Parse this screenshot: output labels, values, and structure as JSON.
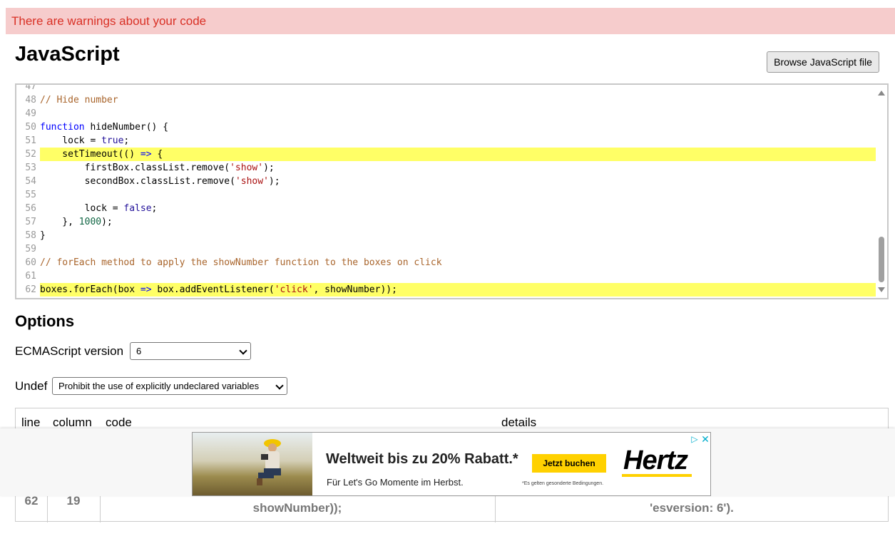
{
  "banner": {
    "warning_text": "There are warnings about your code"
  },
  "page": {
    "title": "JavaScript"
  },
  "toolbar": {
    "browse_label": "Browse JavaScript file"
  },
  "editor": {
    "lines": [
      {
        "num": "47",
        "text": ""
      },
      {
        "num": "48",
        "text": "// Hide number"
      },
      {
        "num": "49",
        "text": ""
      },
      {
        "num": "50",
        "text": "function hideNumber() {"
      },
      {
        "num": "51",
        "text": "    lock = true;"
      },
      {
        "num": "52",
        "text": "    setTimeout(() => {"
      },
      {
        "num": "53",
        "text": "        firstBox.classList.remove('show');"
      },
      {
        "num": "54",
        "text": "        secondBox.classList.remove('show');"
      },
      {
        "num": "55",
        "text": ""
      },
      {
        "num": "56",
        "text": "        lock = false;"
      },
      {
        "num": "57",
        "text": "    }, 1000);"
      },
      {
        "num": "58",
        "text": "}"
      },
      {
        "num": "59",
        "text": ""
      },
      {
        "num": "60",
        "text": "// forEach method to apply the showNumber function to the boxes on click"
      },
      {
        "num": "61",
        "text": ""
      },
      {
        "num": "62",
        "text": "boxes.forEach(box => box.addEventListener('click', showNumber));"
      }
    ],
    "highlighted_lines": [
      "52",
      "62"
    ],
    "highlight_color": "#ffff66"
  },
  "options": {
    "heading": "Options",
    "ecma_label": "ECMAScript version",
    "ecma_value": "6",
    "undef_label": "Undef",
    "undef_value": "Prohibit the use of explicitly undeclared variables"
  },
  "results": {
    "headers": [
      "line",
      "column",
      "code",
      "details"
    ],
    "rows": [
      {
        "line": "62",
        "column": "19",
        "code": "showNumber));",
        "details": "'esversion: 6')."
      }
    ]
  },
  "ad": {
    "headline": "Weltweit bis zu 20% Rabatt.*",
    "subline": "Für Let's Go Momente im Herbst.",
    "cta": "Jetzt buchen",
    "fineprint": "*Es gelten gesonderte Bedingungen.",
    "brand": "Hertz",
    "brand_color": "#ffd100"
  },
  "colors": {
    "warning_bg": "#f6cccc",
    "warning_text": "#d93025"
  }
}
